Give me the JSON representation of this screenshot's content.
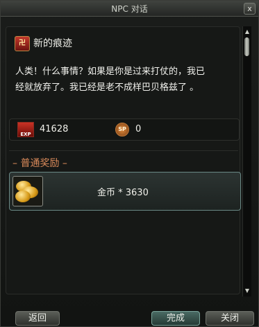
{
  "window": {
    "title": "NPC 对话",
    "close_glyph": "x"
  },
  "quest": {
    "icon_glyph": "卍",
    "title": "新的痕迹",
    "dialog_lines": [
      "人类！什么事情？如果是你是过来打仗的，我已",
      "经就放弃了。我已经是老不成样巴贝格兹了 。"
    ]
  },
  "rewards": {
    "exp_label": "EXP",
    "exp_value": "41628",
    "sp_label": "SP",
    "sp_value": "0"
  },
  "normal_rewards": {
    "header": "– 普通奖励 –",
    "items": [
      {
        "icon": "gold-coins-icon",
        "text": "金币 * 3630"
      }
    ]
  },
  "buttons": {
    "back": "返回",
    "complete": "完成",
    "close": "关闭"
  },
  "colors": {
    "section_header": "#d98a5a",
    "reward_border": "#6b8a86"
  }
}
